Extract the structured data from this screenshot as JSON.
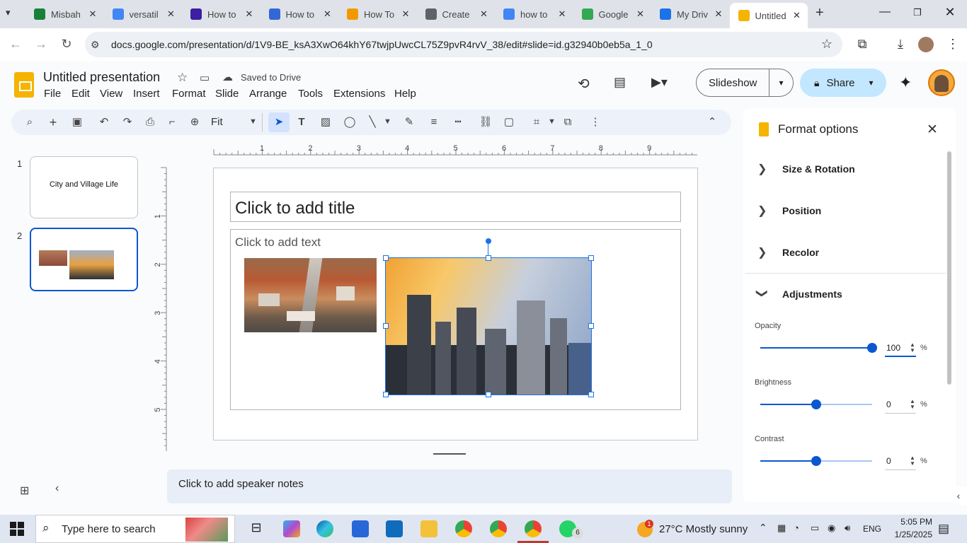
{
  "browser": {
    "tabs": [
      {
        "title": "Misbah",
        "color": "#188038"
      },
      {
        "title": "versatil",
        "color": "#4285f4"
      },
      {
        "title": "How to",
        "color": "#3c1fa3"
      },
      {
        "title": "How to",
        "color": "#3367d6"
      },
      {
        "title": "How To",
        "color": "#f29900"
      },
      {
        "title": "Create",
        "color": "#5f6368"
      },
      {
        "title": "how to",
        "color": "#4285f4"
      },
      {
        "title": "Google",
        "color": "#34a853"
      },
      {
        "title": "My Driv",
        "color": "#1a73e8"
      },
      {
        "title": "Untitled",
        "color": "#f4b400"
      }
    ],
    "url": "docs.google.com/presentation/d/1V9-BE_ksA3XwO64khY67twjpUwcCL75Z9pvR4rvV_38/edit#slide=id.g32940b0eb5a_1_0"
  },
  "doc": {
    "title": "Untitled presentation",
    "saved": "Saved to Drive",
    "menus": [
      "File",
      "Edit",
      "View",
      "Insert",
      "Format",
      "Slide",
      "Arrange",
      "Tools",
      "Extensions",
      "Help"
    ],
    "slideshow": "Slideshow",
    "share": "Share"
  },
  "toolbar": {
    "zoom": "Fit"
  },
  "ruler": {
    "h": [
      "1",
      "2",
      "3",
      "4",
      "5",
      "6",
      "7",
      "8",
      "9"
    ],
    "v": [
      "1",
      "2",
      "3",
      "4",
      "5"
    ]
  },
  "filmstrip": [
    {
      "num": "1",
      "text": "City and Village Life"
    },
    {
      "num": "2",
      "text": ""
    }
  ],
  "slide": {
    "title_placeholder": "Click to add title",
    "body_placeholder": "Click to add text"
  },
  "notes": "Click to add speaker notes",
  "format_panel": {
    "title": "Format options",
    "sections": [
      "Size & Rotation",
      "Position",
      "Recolor",
      "Adjustments"
    ],
    "opacity_label": "Opacity",
    "opacity_value": "100",
    "opacity_level": 1.0,
    "brightness_label": "Brightness",
    "brightness_value": "0",
    "brightness_level": 0.5,
    "contrast_label": "Contrast",
    "contrast_value": "0",
    "contrast_level": 0.5,
    "unit": "%"
  },
  "taskbar": {
    "search_placeholder": "Type here to search",
    "weather": "27°C  Mostly sunny",
    "weather_badge": "1",
    "lang": "ENG",
    "time": "5:05 PM",
    "date": "1/25/2025",
    "whatsapp_badge": "6"
  }
}
